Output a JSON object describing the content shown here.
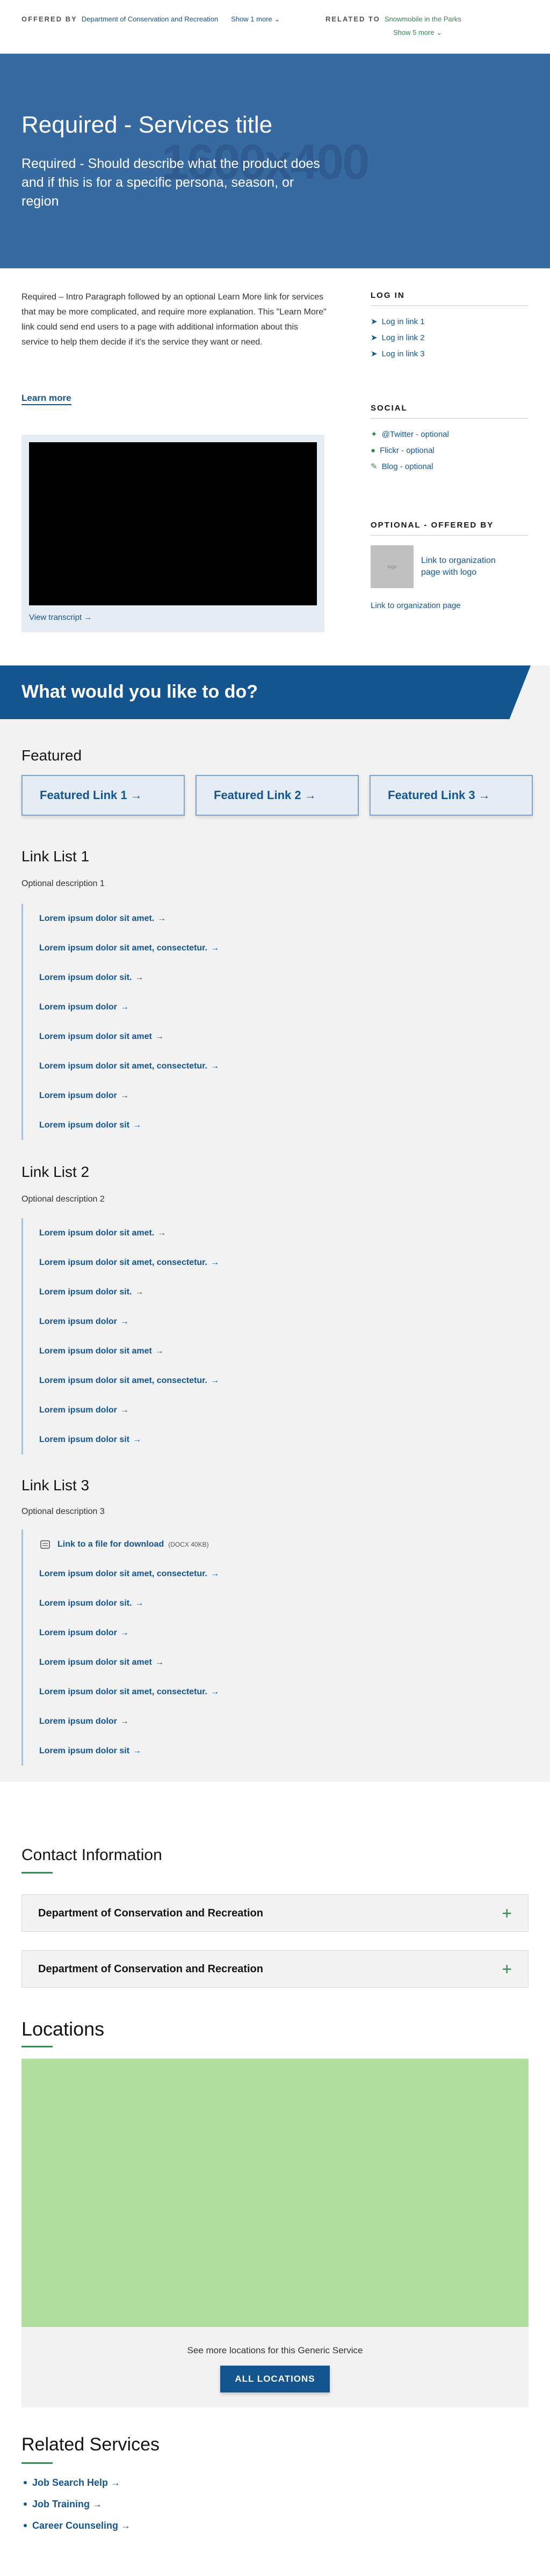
{
  "topbar": {
    "offered_label": "OFFERED BY",
    "offered_link": "Department of Conservation and Recreation",
    "offered_more": "Show 1 more",
    "related_label": "RELATED TO",
    "related_link": "Snowmobile in the Parks",
    "related_more": "Show 5 more"
  },
  "hero": {
    "title": "Required - Services title",
    "subtitle": "Required - Should describe what the product does and if this is for a specific persona, season, or region",
    "ghost": "1600x400"
  },
  "intro": {
    "paragraph": "Required – Intro Paragraph followed by an optional Learn More link for services that may be more complicated, and require more explanation. This \"Learn More\" link could send end users to a page with additional information about this service to help them decide if it's the service they want or need.",
    "learn_more": "Learn more",
    "transcript": "View transcript"
  },
  "sidebar": {
    "login_title": "LOG IN",
    "login_links": [
      "Log in link 1",
      "Log in link 2",
      "Log in link 3"
    ],
    "social_title": "SOCIAL",
    "social_links": [
      "@Twitter - optional",
      "Flickr - optional",
      "Blog - optional"
    ],
    "offered_title": "OPTIONAL - OFFERED BY",
    "org_link": "Link to organization page with logo",
    "org_logo": "logo",
    "org_page": "Link to organization page"
  },
  "what": {
    "heading": "What would you like to do?",
    "featured_title": "Featured",
    "featured": [
      "Featured Link 1",
      "Featured Link 2",
      "Featured Link 3"
    ],
    "lists": [
      {
        "title": "Link List 1",
        "desc": "Optional description 1",
        "items": [
          "Lorem ipsum dolor sit amet.",
          "Lorem ipsum dolor sit amet, consectetur.",
          "Lorem ipsum dolor sit.",
          "Lorem ipsum dolor",
          "Lorem ipsum dolor sit amet",
          "Lorem ipsum dolor sit amet, consectetur.",
          "Lorem ipsum dolor",
          "Lorem ipsum dolor sit"
        ]
      },
      {
        "title": "Link List 2",
        "desc": "Optional description 2",
        "items": [
          "Lorem ipsum dolor sit amet.",
          "Lorem ipsum dolor sit amet, consectetur.",
          "Lorem ipsum dolor sit.",
          "Lorem ipsum dolor",
          "Lorem ipsum dolor sit amet",
          "Lorem ipsum dolor sit amet, consectetur.",
          "Lorem ipsum dolor",
          "Lorem ipsum dolor sit"
        ]
      },
      {
        "title": "Link List 3",
        "desc": "Optional description 3",
        "file_link": "Link to a file for download",
        "file_meta": "(DOCX 40KB)",
        "items": [
          "Lorem ipsum dolor sit amet, consectetur.",
          "Lorem ipsum dolor sit.",
          "Lorem ipsum dolor",
          "Lorem ipsum dolor sit amet",
          "Lorem ipsum dolor sit amet, consectetur.",
          "Lorem ipsum dolor",
          "Lorem ipsum dolor sit"
        ]
      }
    ]
  },
  "contact": {
    "title": "Contact Information",
    "items": [
      "Department of Conservation and Recreation",
      "Department of Conservation and Recreation"
    ]
  },
  "locations": {
    "title": "Locations",
    "more_text": "See more locations for this Generic Service",
    "button": "ALL LOCATIONS"
  },
  "related": {
    "title": "Related Services",
    "items": [
      "Job Search Help",
      "Job Training",
      "Career Counseling"
    ]
  },
  "colors": {
    "primary": "#14558f",
    "hero": "#386aa2",
    "green": "#388557",
    "map": "#b2dea0"
  }
}
